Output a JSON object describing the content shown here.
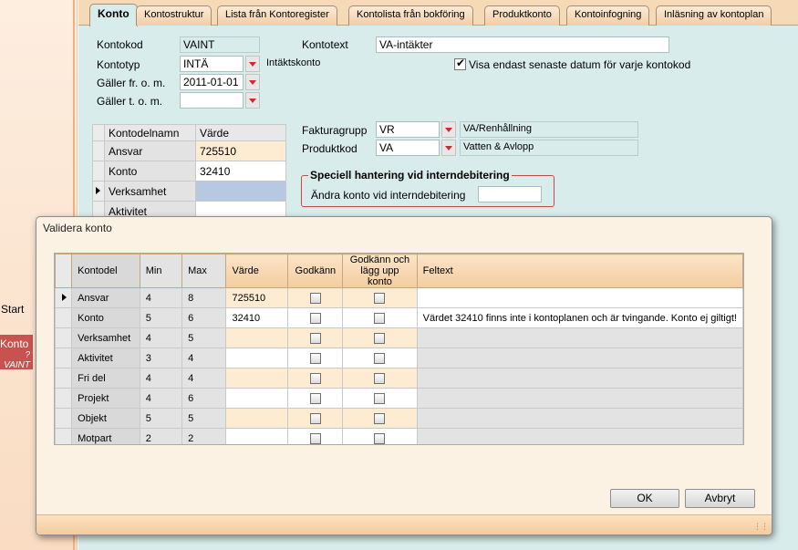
{
  "left_panel": {
    "start_label": "Start",
    "konto_label": "Konto",
    "konto_sub": "VAINT",
    "konto_sub_prefix": "?"
  },
  "tabs": [
    "Konto",
    "Kontostruktur",
    "Lista från Kontoregister",
    "Kontolista från bokföring",
    "Produktkonto",
    "Kontoinfogning",
    "Inläsning av kontoplan"
  ],
  "form": {
    "kontokod_label": "Kontokod",
    "kontokod_value": "VAINT",
    "kontotext_label": "Kontotext",
    "kontotext_value": "VA-intäkter",
    "kontotyp_label": "Kontotyp",
    "kontotyp_value": "INTÄ",
    "kontotyp_desc": "Intäktskonto",
    "visa_label": "Visa endast senaste datum för varje kontokod",
    "visa_checked": true,
    "from_label": "Gäller fr. o. m.",
    "from_value": "2011-01-01",
    "tom_label": "Gäller t. o. m.",
    "tom_value": "",
    "grid_headers": [
      "Kontodelnamn",
      "Värde"
    ],
    "grid_rows": [
      {
        "name": "Ansvar",
        "value": "725510"
      },
      {
        "name": "Konto",
        "value": "32410"
      },
      {
        "name": "Verksamhet",
        "value": ""
      },
      {
        "name": "Aktivitet",
        "value": ""
      }
    ],
    "fakturagrupp_label": "Fakturagrupp",
    "fakturagrupp_value": "VR",
    "fakturagrupp_desc": "VA/Renhållning",
    "produktkod_label": "Produktkod",
    "produktkod_value": "VA",
    "produktkod_desc": "Vatten & Avlopp",
    "special_title": "Speciell hantering vid internde­bitering",
    "special_field_label": "Ändra konto vid interndebitering",
    "special_field_value": ""
  },
  "dialog": {
    "title": "Validera konto",
    "headers": [
      "Kontodel",
      "Min",
      "Max",
      "Värde",
      "Godkänn",
      "Godkänn och lägg upp konto",
      "Feltext"
    ],
    "rows": [
      {
        "name": "Ansvar",
        "min": "4",
        "max": "8",
        "value": "725510",
        "error": ""
      },
      {
        "name": "Konto",
        "min": "5",
        "max": "6",
        "value": "32410",
        "error": "Värdet 32410  finns inte i kontoplanen och är tvingande. Konto ej giltigt!"
      },
      {
        "name": "Verksamhet",
        "min": "4",
        "max": "5",
        "value": "",
        "error": ""
      },
      {
        "name": "Aktivitet",
        "min": "3",
        "max": "4",
        "value": "",
        "error": ""
      },
      {
        "name": "Fri del",
        "min": "4",
        "max": "4",
        "value": "",
        "error": ""
      },
      {
        "name": "Projekt",
        "min": "4",
        "max": "6",
        "value": "",
        "error": ""
      },
      {
        "name": "Objekt",
        "min": "5",
        "max": "5",
        "value": "",
        "error": ""
      },
      {
        "name": "Motpart",
        "min": "2",
        "max": "2",
        "value": "",
        "error": ""
      }
    ],
    "ok_label": "OK",
    "cancel_label": "Avbryt"
  }
}
